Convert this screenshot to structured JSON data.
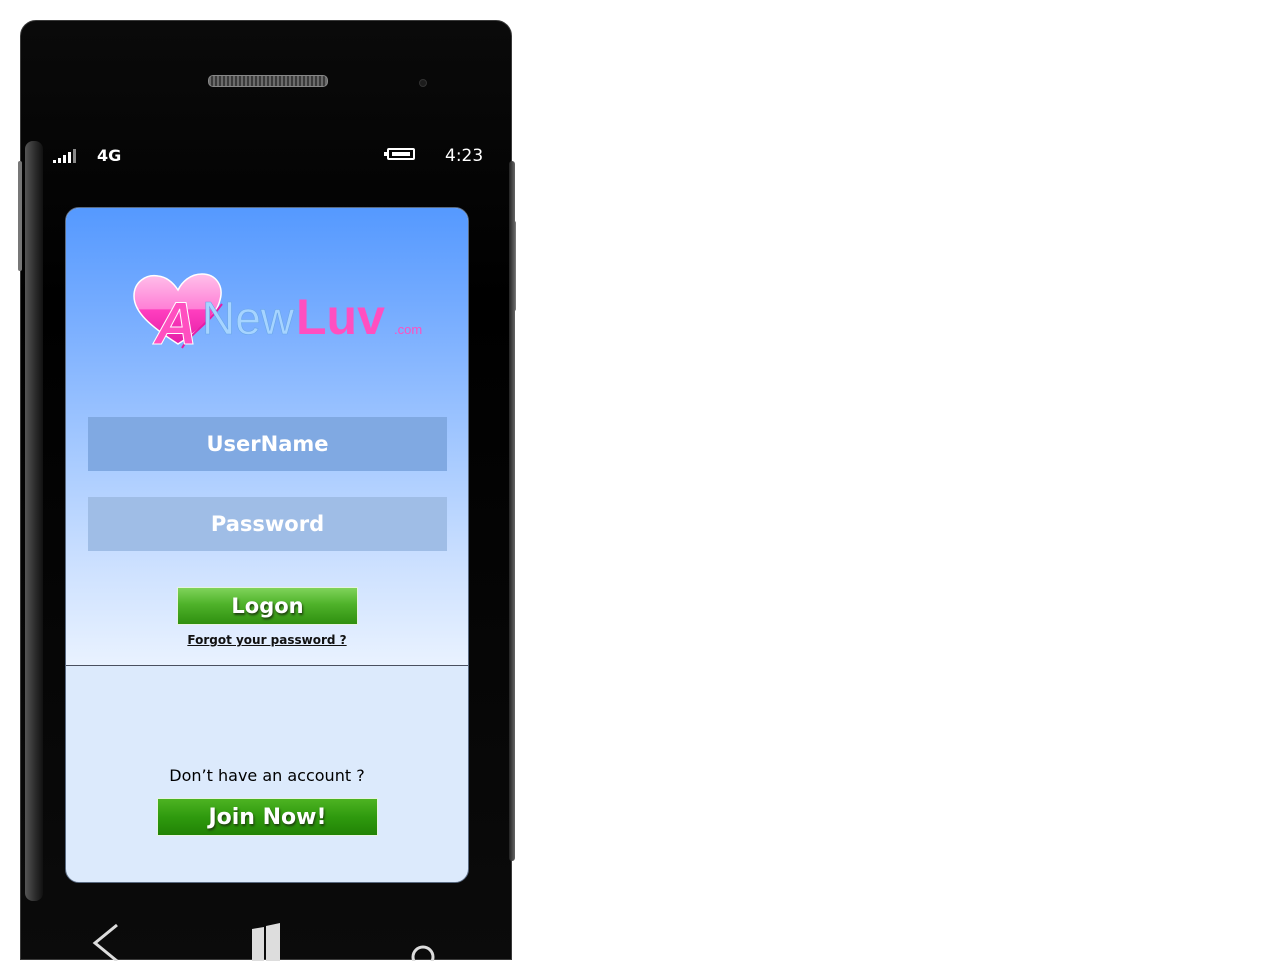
{
  "status_bar": {
    "network": "4G",
    "time": "4:23",
    "signal_icon": "signal-strength-icon",
    "battery_icon": "battery-icon"
  },
  "logo": {
    "brand_a": "A",
    "brand_new": "New",
    "brand_luv": "Luv",
    "brand_tld": ".com",
    "icon": "heart-logo-icon",
    "colors": {
      "pink": "#ff4fc0",
      "light_blue": "#a6d4ff"
    }
  },
  "login": {
    "username_placeholder": "UserName",
    "password_placeholder": "Password",
    "logon_label": "Logon",
    "forgot_label": "Forgot your password ?"
  },
  "signup": {
    "prompt": "Don’t have an account ?",
    "join_label": "Join Now!"
  },
  "nav": {
    "back_icon": "back-arrow-icon",
    "home_icon": "windows-start-icon",
    "search_icon": "search-icon"
  },
  "colors": {
    "button_green": "#3fa51b",
    "screen_top": "#5599ff",
    "screen_bottom": "#dceafc"
  }
}
